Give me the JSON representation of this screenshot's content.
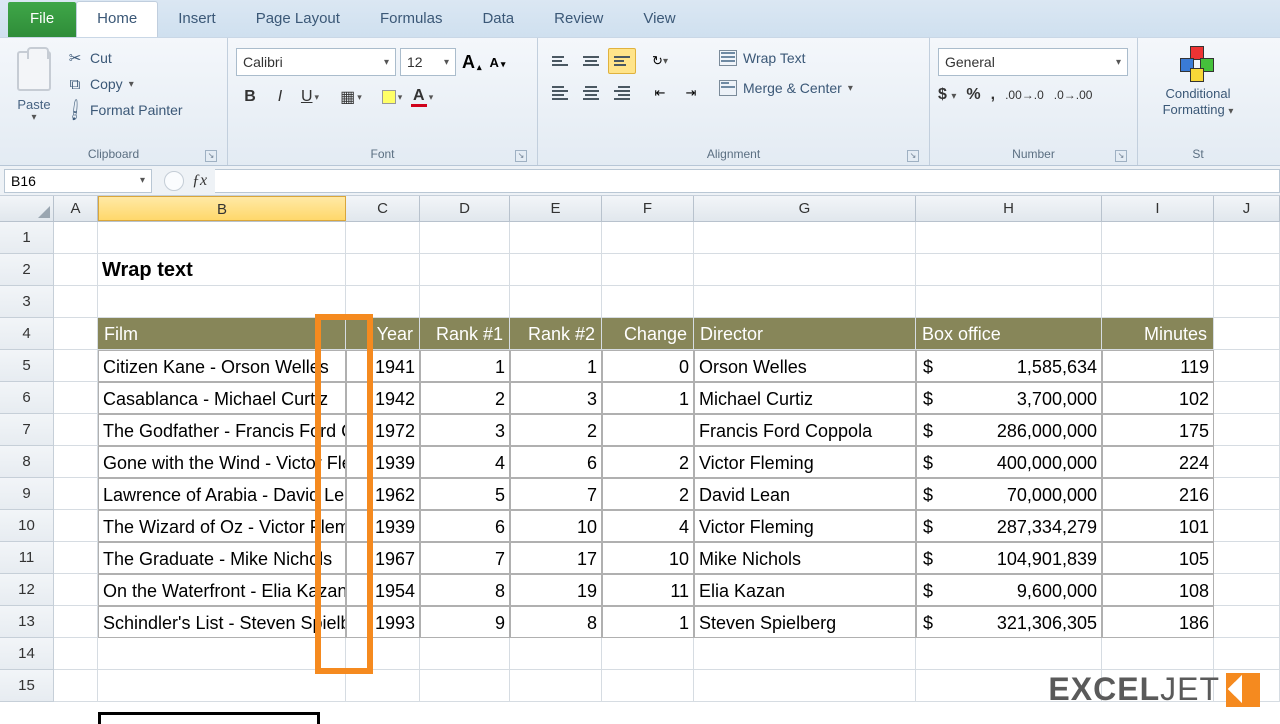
{
  "tabs": {
    "file": "File",
    "home": "Home",
    "insert": "Insert",
    "layout": "Page Layout",
    "formulas": "Formulas",
    "data": "Data",
    "review": "Review",
    "view": "View"
  },
  "ribbon": {
    "clipboard": {
      "paste": "Paste",
      "cut": "Cut",
      "copy": "Copy",
      "painter": "Format Painter",
      "label": "Clipboard"
    },
    "font": {
      "name": "Calibri",
      "size": "12",
      "label": "Font"
    },
    "alignment": {
      "wrap": "Wrap Text",
      "merge": "Merge & Center",
      "label": "Alignment"
    },
    "number": {
      "format": "General",
      "label": "Number"
    },
    "cf": {
      "label1": "Conditional",
      "label2": "Formatting"
    },
    "trailing": "St"
  },
  "namebox": "B16",
  "cols": [
    "A",
    "B",
    "C",
    "D",
    "E",
    "F",
    "G",
    "H",
    "I",
    "J"
  ],
  "rows": [
    "1",
    "2",
    "3",
    "4",
    "5",
    "6",
    "7",
    "8",
    "9",
    "10",
    "11",
    "12",
    "13",
    "14",
    "15"
  ],
  "title": "Wrap text",
  "headers": {
    "film": "Film",
    "year": "Year",
    "r1": "Rank #1",
    "r2": "Rank #2",
    "ch": "Change",
    "dir": "Director",
    "box": "Box office",
    "min": "Minutes"
  },
  "data": [
    {
      "film": "Citizen Kane - Orson Welles",
      "year": "1941",
      "r1": "1",
      "r2": "1",
      "ch": "0",
      "dir": "Orson Welles",
      "box": "1,585,634",
      "min": "119"
    },
    {
      "film": "Casablanca - Michael Curtiz",
      "year": "1942",
      "r1": "2",
      "r2": "3",
      "ch": "1",
      "dir": "Michael Curtiz",
      "box": "3,700,000",
      "min": "102"
    },
    {
      "film": "The Godfather - Francis Ford Coppola",
      "year": "1972",
      "r1": "3",
      "r2": "2",
      "ch": "",
      "dir": "Francis Ford Coppola",
      "box": "286,000,000",
      "min": "175"
    },
    {
      "film": "Gone with the Wind - Victor Fleming",
      "year": "1939",
      "r1": "4",
      "r2": "6",
      "ch": "2",
      "dir": "Victor Fleming",
      "box": "400,000,000",
      "min": "224"
    },
    {
      "film": "Lawrence of Arabia - David Lean",
      "year": "1962",
      "r1": "5",
      "r2": "7",
      "ch": "2",
      "dir": "David Lean",
      "box": "70,000,000",
      "min": "216"
    },
    {
      "film": "The Wizard of Oz - Victor Fleming",
      "year": "1939",
      "r1": "6",
      "r2": "10",
      "ch": "4",
      "dir": "Victor Fleming",
      "box": "287,334,279",
      "min": "101"
    },
    {
      "film": "The Graduate - Mike Nichols",
      "year": "1967",
      "r1": "7",
      "r2": "17",
      "ch": "10",
      "dir": "Mike Nichols",
      "box": "104,901,839",
      "min": "105"
    },
    {
      "film": "On the Waterfront - Elia Kazan",
      "year": "1954",
      "r1": "8",
      "r2": "19",
      "ch": "11",
      "dir": "Elia Kazan",
      "box": "9,600,000",
      "min": "108"
    },
    {
      "film": "Schindler's List - Steven Spielberg",
      "year": "1993",
      "r1": "9",
      "r2": "8",
      "ch": "1",
      "dir": "Steven Spielberg",
      "box": "321,306,305",
      "min": "186"
    }
  ],
  "logo": {
    "a": "EXCEL",
    "b": "JET"
  }
}
